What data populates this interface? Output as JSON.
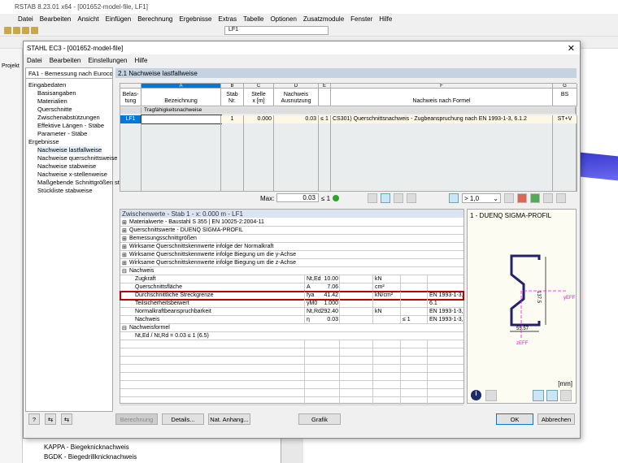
{
  "app": {
    "title": "RSTAB 8.23.01 x64 - [001652-model-file, LF1]",
    "menu": [
      "Datei",
      "Bearbeiten",
      "Ansicht",
      "Einfügen",
      "Berechnung",
      "Ergebnisse",
      "Extras",
      "Tabelle",
      "Optionen",
      "Zusatzmodule",
      "Fenster",
      "Hilfe"
    ],
    "loadcase": "LF1",
    "side_tab": "Projekt",
    "bg_tree": [
      "KAPPA - Biegeknicknachweis",
      "BGDK - Biegedrillknicknachweis"
    ]
  },
  "dialog": {
    "title": "STAHL EC3 - [001652-model-file]",
    "menu": [
      "Datei",
      "Bearbeiten",
      "Einstellungen",
      "Hilfe"
    ],
    "nav": {
      "selector": "FA1 - Bemessung nach Eurocode",
      "group1": "Eingabedaten",
      "items1": [
        "Basisangaben",
        "Materialien",
        "Querschnitte",
        "Zwischenabstützungen",
        "Effektive Längen - Stäbe",
        "Parameter - Stäbe"
      ],
      "group2": "Ergebnisse",
      "items2": [
        "Nachweise lastfallweise",
        "Nachweise querschnittsweise",
        "Nachweise stabweise",
        "Nachweise x-stellenweise",
        "Maßgebende Schnittgrößen stabweise",
        "Stückliste stabweise"
      ]
    },
    "panel_title": "2.1 Nachweise lastfallweise",
    "table": {
      "letters": [
        "A",
        "B",
        "C",
        "D",
        "E",
        "F",
        "G"
      ],
      "headers": {
        "belastung": "Belas-\ntung",
        "a": "Bezeichnung",
        "b": "Stab\nNr.",
        "c": "Stelle\nx [m]",
        "d": "Nachweis\nAusnutzung",
        "f": "Nachweis nach Formel",
        "g": "BS"
      },
      "group": "Tragfähigkeitsnachweise",
      "row": {
        "lf": "LF1",
        "bez": "",
        "stab": "1",
        "x": "0.000",
        "ausn": "0.03",
        "le": "≤ 1",
        "formel": "CS301) Querschnittsnachweis - Zugbeanspruchung nach EN 1993-1-3, 6.1.2",
        "bs": "ST+V"
      }
    },
    "max": {
      "label": "Max:",
      "value": "0.03",
      "le": "≤ 1",
      "filter": "> 1,0"
    },
    "zw": {
      "title": "Zwischenwerte - Stab 1 - x: 0.000 m - LF1",
      "sections": [
        "Materialwerte - Baustahl S 355 | EN 10025-2:2004-11",
        "Querschnittswerte  -  DUENQ SIGMA-PROFIL",
        "Bemessungsschnittgrößen",
        "Wirksame Querschnittskennwerte infolge der Normalkraft",
        "Wirksame Querschnittskennwerte infolge Biegung um die y-Achse",
        "Wirksame Querschnittskennwerte infolge Biegung um die z-Achse",
        "Nachweis"
      ],
      "rows": [
        {
          "name": "Zugkraft",
          "sym": "Nt,Ed",
          "val": "10.00",
          "unit": "kN",
          "le": "",
          "ref": ""
        },
        {
          "name": "Querschnittsfläche",
          "sym": "A",
          "val": "7.06",
          "unit": "cm²",
          "le": "",
          "ref": ""
        },
        {
          "name": "Durchschnittliche Streckgrenze",
          "sym": "fya",
          "val": "41.42",
          "unit": "kN/cm²",
          "le": "",
          "ref": "EN 1993-1-3,"
        },
        {
          "name": "Teilsicherheitsbeiwert",
          "sym": "γM0",
          "val": "1.000",
          "unit": "",
          "le": "",
          "ref": "6.1"
        },
        {
          "name": "Normalkraftbeanspruchbarkeit",
          "sym": "Nt,Rd",
          "val": "292.40",
          "unit": "kN",
          "le": "",
          "ref": "EN 1993-1-3,"
        },
        {
          "name": "Nachweis",
          "sym": "η",
          "val": "0.03",
          "unit": "",
          "le": "≤ 1",
          "ref": "EN 1993-1-3,"
        }
      ],
      "formula_section": "Nachweisformel",
      "formula": "Nt,Ed / Nt,Rd = 0.03 ≤ 1   (6.5)"
    },
    "graphic": {
      "title": "1 - DUENQ SIGMA-PROFIL",
      "dim_h": "137.5",
      "dim_b": "55.57",
      "axis_y": "yEFF",
      "axis_z": "zEFF",
      "unit": "[mm]"
    },
    "buttons": {
      "calc": "Berechnung",
      "details": "Details...",
      "nat": "Nat. Anhang...",
      "grafik": "Grafik",
      "ok": "OK",
      "cancel": "Abbrechen"
    },
    "colors": {
      "highlight": "#c00000",
      "selection": "#0078d7",
      "header": "#c5d3e0",
      "ok_icon": "#2aa52a"
    }
  }
}
